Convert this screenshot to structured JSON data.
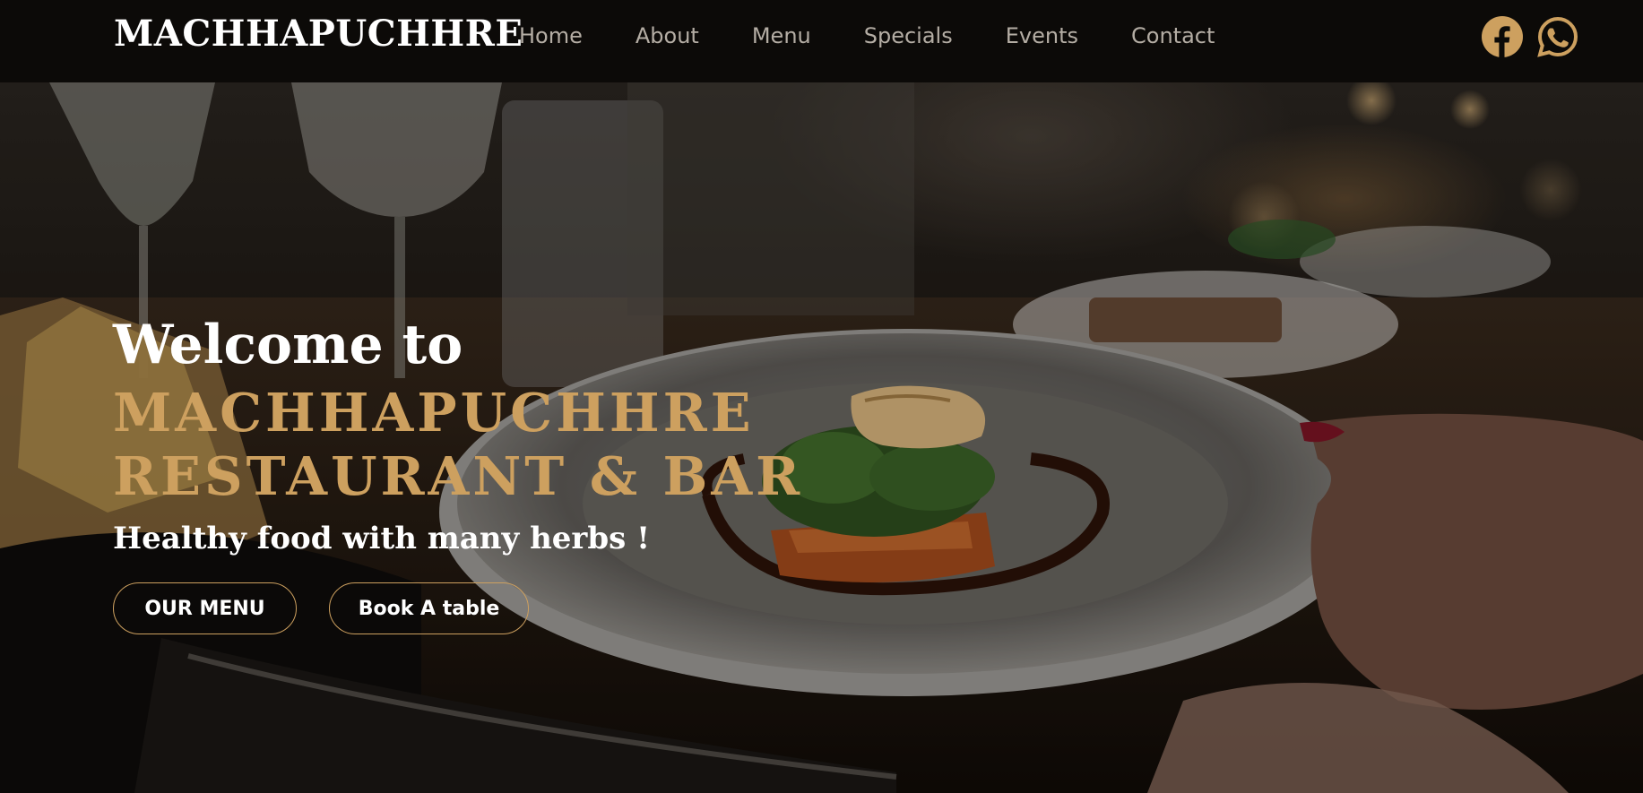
{
  "header": {
    "brand": "MACHHAPUCHHRE",
    "nav": [
      "Home",
      "About",
      "Menu",
      "Specials",
      "Events",
      "Contact"
    ],
    "social": [
      {
        "icon": "facebook-icon",
        "color": "#cda05f"
      },
      {
        "icon": "whatsapp-icon",
        "color": "#cda05f"
      }
    ]
  },
  "hero": {
    "welcome": "Welcome to",
    "title_line1": "MACHHAPUCHHRE",
    "title_line2": "RESTAURANT & BAR",
    "tagline": "Healthy food with many herbs !",
    "buttons": {
      "menu": "OUR MENU",
      "book": "Book A table"
    }
  },
  "colors": {
    "accent": "#cda05f",
    "header_bg": "#0c0a08",
    "nav_text": "#b4ada4"
  }
}
